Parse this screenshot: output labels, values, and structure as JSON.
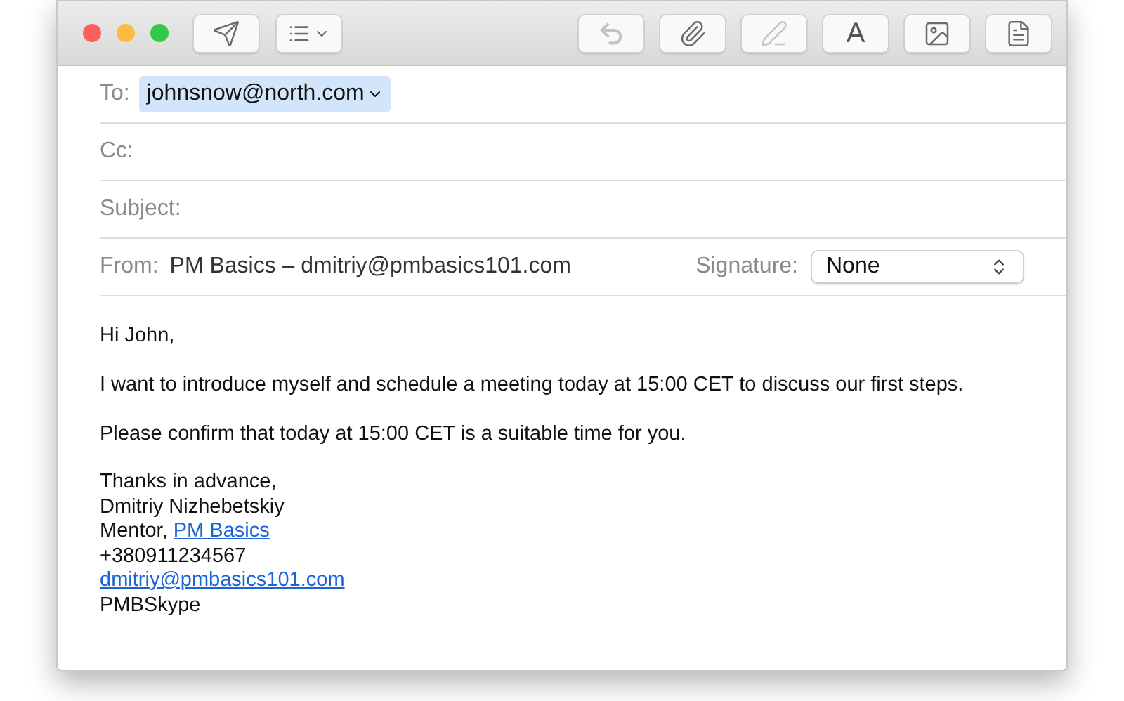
{
  "toolbar": {
    "left": [
      {
        "kind": "send",
        "disabled": false
      },
      {
        "kind": "list",
        "disabled": false
      }
    ],
    "right": [
      {
        "kind": "reply",
        "disabled": true
      },
      {
        "kind": "attach",
        "disabled": false
      },
      {
        "kind": "markup",
        "disabled": true
      },
      {
        "kind": "font",
        "label": "A",
        "disabled": false
      },
      {
        "kind": "photo",
        "disabled": false
      },
      {
        "kind": "format",
        "disabled": false
      }
    ]
  },
  "header": {
    "to": {
      "label": "To:",
      "recipient": "johnsnow@north.com"
    },
    "cc": {
      "label": "Cc:"
    },
    "subject": {
      "label": "Subject:"
    },
    "from": {
      "label": "From:",
      "value": "PM Basics – dmitriy@pmbasics101.com"
    },
    "signature": {
      "label": "Signature:",
      "value": "None"
    }
  },
  "body": {
    "paragraphs": [
      "Hi John,",
      "I want to introduce myself and schedule a meeting today at 15:00 CET to discuss our first steps.",
      "Please confirm that today at 15:00 CET is a suitable time for you."
    ],
    "signature": [
      [
        {
          "kind": "text",
          "text": "Thanks in advance,"
        }
      ],
      [
        {
          "kind": "text",
          "text": "Dmitriy Nizhebetskiy"
        }
      ],
      [
        {
          "kind": "text",
          "text": "Mentor, "
        },
        {
          "kind": "link",
          "text": "PM Basics"
        }
      ],
      [
        {
          "kind": "text",
          "text": "+380911234567"
        }
      ],
      [
        {
          "kind": "link",
          "text": "dmitriy@pmbasics101.com"
        }
      ],
      [
        {
          "kind": "text",
          "text": "PMBSkype"
        }
      ]
    ]
  }
}
